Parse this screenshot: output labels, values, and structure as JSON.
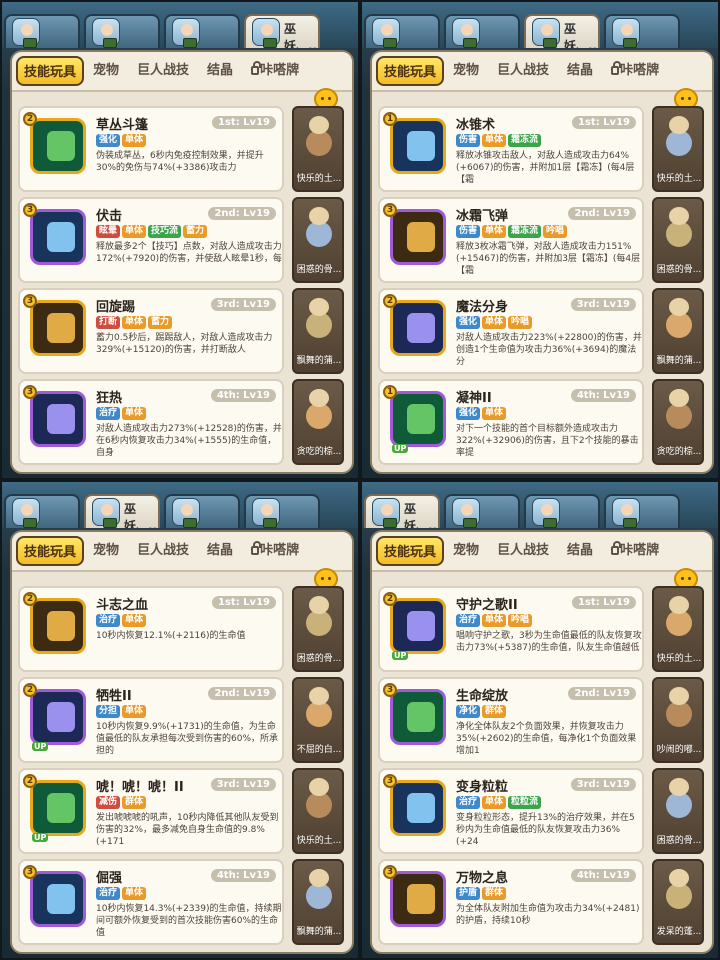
{
  "colors": {
    "accent": "#f4bb24",
    "tag_blue": "#3f88c9",
    "tag_orange": "#e89a2a",
    "tag_red": "#cf4d3f",
    "tag_green": "#3da44b"
  },
  "panels": [
    {
      "active_char": 3,
      "chars": [
        {
          "name": ""
        },
        {
          "name": ""
        },
        {
          "name": ""
        },
        {
          "name": "巫妖、.."
        }
      ],
      "tabs": [
        "技能玩具",
        "宠物",
        "巨人战技",
        "结晶",
        "咔嗒牌"
      ],
      "chat_label": "聊天",
      "skills": [
        {
          "name": "草丛斗篷",
          "slot": "1st: Lv19",
          "rank": "2",
          "up": "",
          "tags": [
            [
              "强化",
              "blue"
            ],
            [
              "单体",
              "orange"
            ]
          ],
          "desc": "伪装成草丛，6秒内免疫控制效果，并提升30%的免伤与74%(+3386)攻击力"
        },
        {
          "name": "伏击",
          "slot": "2nd: Lv19",
          "rank": "3",
          "up": "",
          "tags": [
            [
              "眩晕",
              "red"
            ],
            [
              "单体",
              "orange"
            ],
            [
              "技巧流",
              "green"
            ],
            [
              "蓄力",
              "orange"
            ]
          ],
          "desc": "释放最多2个【技巧】点数，对敌人造成攻击力172%(+7920)的伤害，并使敌人眩晕1秒，每"
        },
        {
          "name": "回旋踢",
          "slot": "3rd: Lv19",
          "rank": "3",
          "up": "",
          "tags": [
            [
              "打断",
              "red"
            ],
            [
              "单体",
              "orange"
            ],
            [
              "蓄力",
              "orange"
            ]
          ],
          "desc": "蓄力0.5秒后，踢踢敌人，对敌人造成攻击力329%(+15120)的伤害，并打断敌人"
        },
        {
          "name": "狂热",
          "slot": "4th: Lv19",
          "rank": "3",
          "up": "",
          "tags": [
            [
              "治疗",
              "blue"
            ],
            [
              "单体",
              "orange"
            ]
          ],
          "desc": "对敌人造成攻击力273%(+12528)的伤害，并在6秒内恢复攻击力34%(+1555)的生命值，自身"
        }
      ],
      "pets": [
        "快乐的土...",
        "困惑的骨...",
        "飘舞的蒲...",
        "贪吃的棕..."
      ]
    },
    {
      "active_char": 2,
      "chars": [
        {
          "name": ""
        },
        {
          "name": ""
        },
        {
          "name": "巫妖、.."
        },
        {
          "name": ""
        }
      ],
      "tabs": [
        "技能玩具",
        "宠物",
        "巨人战技",
        "结晶",
        "咔嗒牌"
      ],
      "chat_label": "聊天",
      "skills": [
        {
          "name": "冰锥术",
          "slot": "1st: Lv19",
          "rank": "1",
          "up": "",
          "tags": [
            [
              "伤害",
              "blue"
            ],
            [
              "单体",
              "orange"
            ],
            [
              "霜冻流",
              "green"
            ]
          ],
          "desc": "释放冰锥攻击敌人，对敌人造成攻击力64%(+6067)的伤害，并附加1层【霜冻】(每4层【霜"
        },
        {
          "name": "冰霜飞弹",
          "slot": "2nd: Lv19",
          "rank": "3",
          "up": "",
          "tags": [
            [
              "伤害",
              "blue"
            ],
            [
              "单体",
              "orange"
            ],
            [
              "霜冻流",
              "green"
            ],
            [
              "吟唱",
              "orange"
            ]
          ],
          "desc": "释放3枚冰霜飞弹，对敌人造成攻击力151%(+15467)的伤害，并附加3层【霜冻】(每4层【霜"
        },
        {
          "name": "魔法分身",
          "slot": "3rd: Lv19",
          "rank": "2",
          "up": "",
          "tags": [
            [
              "强化",
              "blue"
            ],
            [
              "单体",
              "orange"
            ],
            [
              "吟唱",
              "orange"
            ]
          ],
          "desc": "对敌人造成攻击力223%(+22800)的伤害，并创造1个生命值为攻击力36%(+3694)的魔法分"
        },
        {
          "name": "凝神II",
          "slot": "4th: Lv19",
          "rank": "1",
          "up": "UP",
          "tags": [
            [
              "强化",
              "blue"
            ],
            [
              "单体",
              "orange"
            ]
          ],
          "desc": "对下一个技能的首个目标额外造成攻击力322%(+32906)的伤害，且下2个技能的暴击率提"
        }
      ],
      "pets": [
        "快乐的土...",
        "困惑的骨...",
        "飘舞的蒲...",
        "贪吃的棕..."
      ]
    },
    {
      "active_char": 1,
      "chars": [
        {
          "name": ""
        },
        {
          "name": "巫妖、.."
        },
        {
          "name": ""
        },
        {
          "name": ""
        }
      ],
      "tabs": [
        "技能玩具",
        "宠物",
        "巨人战技",
        "结晶",
        "咔嗒牌"
      ],
      "chat_label": "聊天",
      "skills": [
        {
          "name": "斗志之血",
          "slot": "1st: Lv19",
          "rank": "2",
          "up": "",
          "tags": [
            [
              "治疗",
              "blue"
            ],
            [
              "单体",
              "orange"
            ]
          ],
          "desc": "10秒内恢复12.1%(+2116)的生命值"
        },
        {
          "name": "牺牲II",
          "slot": "2nd: Lv19",
          "rank": "2",
          "up": "UP",
          "tags": [
            [
              "分担",
              "blue"
            ],
            [
              "单体",
              "orange"
            ]
          ],
          "desc": "10秒内恢复9.9%(+1731)的生命值，为生命值最低的队友承担每次受到伤害的60%，所承担的"
        },
        {
          "name": "唬！唬！唬！II",
          "slot": "3rd: Lv19",
          "rank": "2",
          "up": "UP",
          "tags": [
            [
              "减伤",
              "red"
            ],
            [
              "群体",
              "orange"
            ]
          ],
          "desc": "发出唬唬唬的吼声，10秒内降低其他队友受到伤害的32%，最多减免自身生命值的9.8%(+171"
        },
        {
          "name": "倔强",
          "slot": "4th: Lv19",
          "rank": "3",
          "up": "",
          "tags": [
            [
              "治疗",
              "blue"
            ],
            [
              "单体",
              "orange"
            ]
          ],
          "desc": "10秒内恢复14.3%(+2339)的生命值，持续期间可额外恢复受到的首次技能伤害60%的生命值"
        }
      ],
      "pets": [
        "困惑的骨...",
        "不屈的白...",
        "快乐的土...",
        "飘舞的蒲..."
      ]
    },
    {
      "active_char": 0,
      "chars": [
        {
          "name": "巫妖、.."
        },
        {
          "name": ""
        },
        {
          "name": ""
        },
        {
          "name": ""
        }
      ],
      "tabs": [
        "技能玩具",
        "宠物",
        "巨人战技",
        "结晶",
        "咔嗒牌"
      ],
      "chat_label": "聊天",
      "skills": [
        {
          "name": "守护之歌II",
          "slot": "1st: Lv19",
          "rank": "2",
          "up": "UP",
          "tags": [
            [
              "治疗",
              "blue"
            ],
            [
              "单体",
              "orange"
            ],
            [
              "吟唱",
              "orange"
            ]
          ],
          "desc": "唱响守护之歌，3秒为生命值最低的队友恢复攻击力73%(+5387)的生命值，队友生命值越低"
        },
        {
          "name": "生命绽放",
          "slot": "2nd: Lv19",
          "rank": "3",
          "up": "",
          "tags": [
            [
              "净化",
              "blue"
            ],
            [
              "群体",
              "orange"
            ]
          ],
          "desc": "净化全体队友2个负面效果，并恢复攻击力35%(+2602)的生命值，每净化1个负面效果增加1"
        },
        {
          "name": "变身粒粒",
          "slot": "3rd: Lv19",
          "rank": "3",
          "up": "",
          "tags": [
            [
              "治疗",
              "blue"
            ],
            [
              "单体",
              "orange"
            ],
            [
              "粒粒流",
              "green"
            ]
          ],
          "desc": "变身粒粒形态，提升13%的治疗效果，并在5秒内为生命值最低的队友恢复攻击力36%(+24"
        },
        {
          "name": "万物之息",
          "slot": "4th: Lv19",
          "rank": "3",
          "up": "",
          "tags": [
            [
              "护盾",
              "blue"
            ],
            [
              "群体",
              "orange"
            ]
          ],
          "desc": "为全体队友附加生命值为攻击力34%(+2481)的护盾，持续10秒"
        }
      ],
      "pets": [
        "快乐的土...",
        "吵闹的嘟...",
        "困惑的骨...",
        "发呆的蓬..."
      ]
    }
  ]
}
